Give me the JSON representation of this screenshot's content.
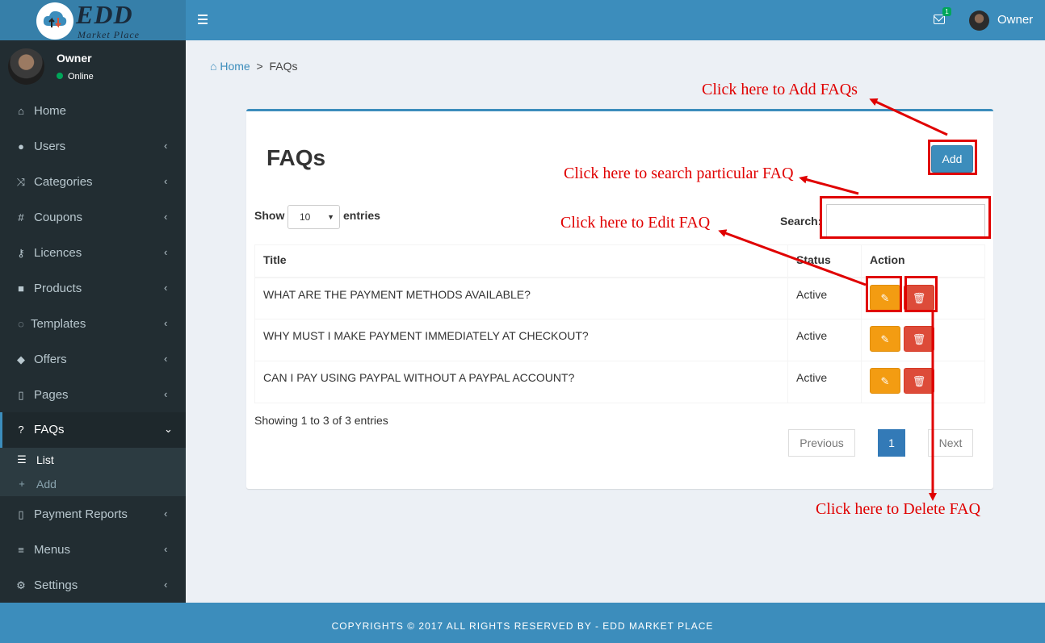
{
  "header": {
    "logo_title": "EDD",
    "logo_subtitle": "Market Place",
    "mail_count": "1",
    "user_name": "Owner"
  },
  "sidebar": {
    "user_name": "Owner",
    "user_status": "Online",
    "items": [
      {
        "label": "Home",
        "icon": "home-icon"
      },
      {
        "label": "Users",
        "icon": "users-icon"
      },
      {
        "label": "Categories",
        "icon": "shuffle-icon"
      },
      {
        "label": "Coupons",
        "icon": "hashtag-icon"
      },
      {
        "label": "Licences",
        "icon": "key-icon"
      },
      {
        "label": "Products",
        "icon": "briefcase-icon"
      },
      {
        "label": "Templates",
        "icon": "comment-icon"
      },
      {
        "label": "Offers",
        "icon": "tags-icon"
      },
      {
        "label": "Pages",
        "icon": "file-icon"
      },
      {
        "label": "FAQs",
        "icon": "question-icon"
      },
      {
        "label": "Payment Reports",
        "icon": "file-icon"
      },
      {
        "label": "Menus",
        "icon": "bars-icon"
      },
      {
        "label": "Settings",
        "icon": "gear-icon"
      }
    ],
    "faq_submenu": [
      {
        "label": "List",
        "icon": "list-icon"
      },
      {
        "label": "Add",
        "icon": "plus-icon"
      }
    ]
  },
  "breadcrumb": {
    "home": "Home",
    "separator": ">",
    "current": "FAQs"
  },
  "main": {
    "title": "FAQs",
    "add_label": "Add",
    "show_label": "Show",
    "entries_value": "10",
    "entries_label": "entries",
    "search_label": "Search:",
    "search_value": "",
    "columns": [
      "Title",
      "Status",
      "Action"
    ],
    "rows": [
      {
        "title": "WHAT ARE THE PAYMENT METHODS AVAILABLE?",
        "status": "Active"
      },
      {
        "title": "WHY MUST I MAKE PAYMENT IMMEDIATELY AT CHECKOUT?",
        "status": "Active"
      },
      {
        "title": "CAN I PAY USING PAYPAL WITHOUT A PAYPAL ACCOUNT?",
        "status": "Active"
      }
    ],
    "info": "Showing 1 to 3 of 3 entries",
    "pagination": {
      "previous": "Previous",
      "current": "1",
      "next": "Next"
    }
  },
  "annotations": {
    "add": "Click here to Add FAQs",
    "search": "Click here to search particular FAQ",
    "edit": "Click here to Edit FAQ",
    "delete": "Click here to Delete FAQ",
    "color": "#e00000"
  },
  "footer": {
    "text": "COPYRIGHTS © 2017 ALL RIGHTS RESERVED BY - EDD MARKET PLACE"
  },
  "colors": {
    "primary": "#3c8dbc",
    "sidebar": "#222d32",
    "edit": "#f39c12",
    "delete": "#dd4b39"
  }
}
